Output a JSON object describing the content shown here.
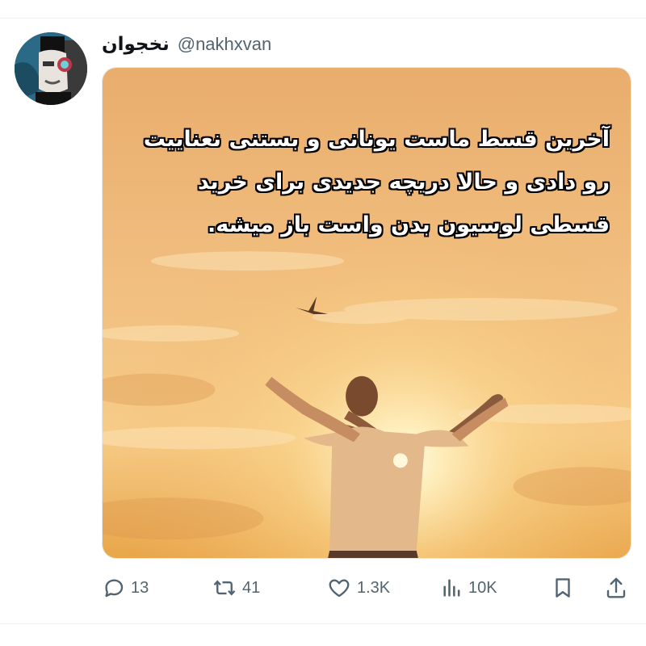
{
  "tweet": {
    "author": {
      "display_name": "نخجوان",
      "handle": "@nakhxvan",
      "avatar_icon": "avatar-image"
    },
    "media": {
      "caption_lines": [
        "آخرین قسط ماست یونانی و بستنی نعناییت",
        "رو دادی و حالا دریچه جدیدی برای خرید",
        "قسطی لوسیون بدن واست باز میشه."
      ]
    },
    "actions": {
      "replies": "13",
      "reposts": "41",
      "likes": "1.3K",
      "views": "10K"
    }
  }
}
